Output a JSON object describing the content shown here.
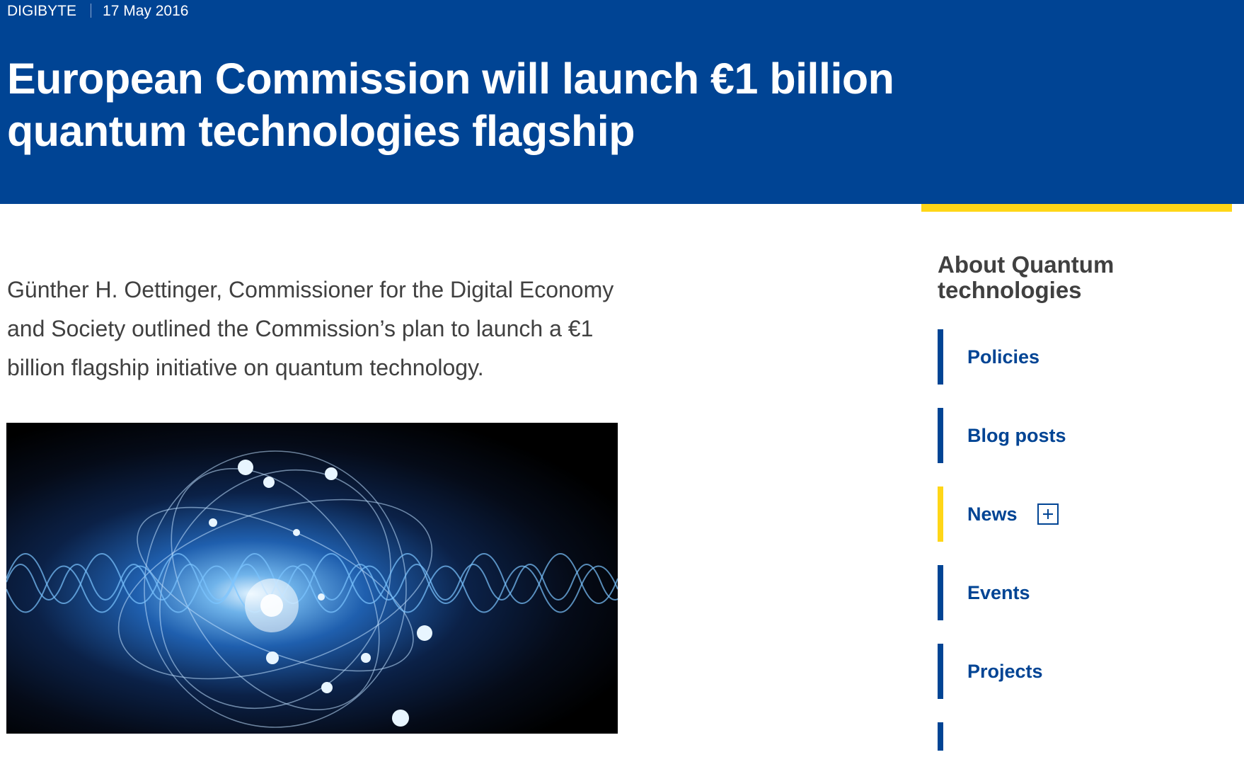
{
  "header": {
    "category": "DIGIBYTE",
    "date": "17 May 2016",
    "title": "European Commission will launch €1 billion quantum technologies flagship"
  },
  "article": {
    "lead": "Günther H. Oettinger, Commissioner for the Digital Economy and Society outlined the Commission’s plan to launch a €1 billion flagship initiative on quantum technology."
  },
  "sidebar": {
    "title": "About Quantum technologies",
    "items": [
      {
        "label": "Policies"
      },
      {
        "label": "Blog posts"
      },
      {
        "label": "News",
        "expand_icon": "plus-box-icon"
      },
      {
        "label": "Events"
      },
      {
        "label": "Projects"
      },
      {
        "label": ""
      }
    ]
  },
  "colors": {
    "header_bg": "#004494",
    "accent_yellow": "#ffd617",
    "link_blue": "#004494",
    "body_text": "#404040"
  }
}
